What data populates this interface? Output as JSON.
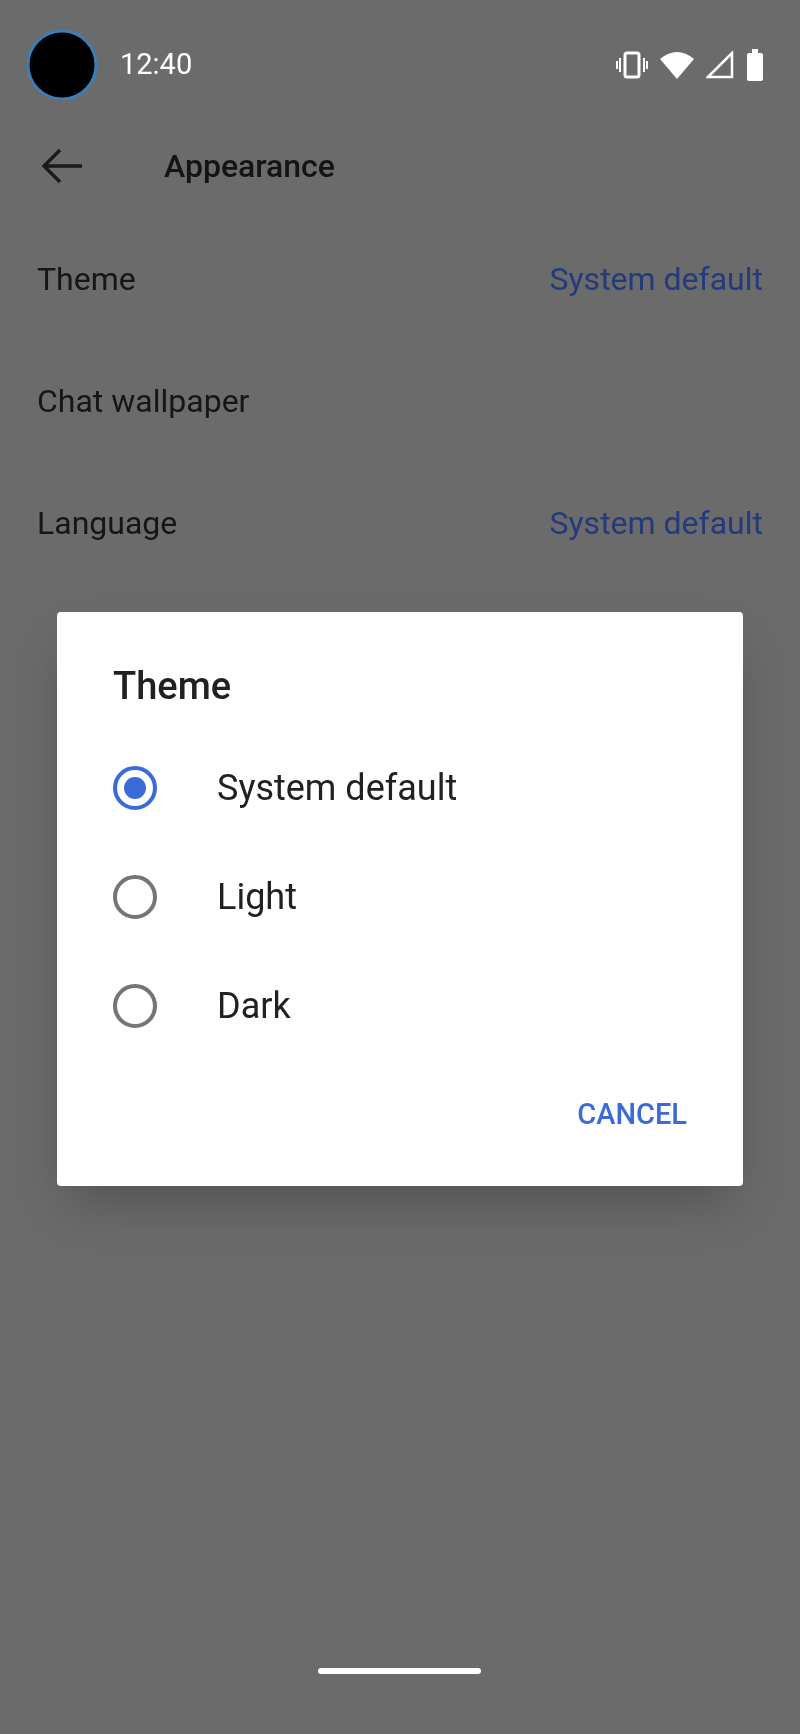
{
  "status_bar": {
    "time": "12:40"
  },
  "toolbar": {
    "title": "Appearance"
  },
  "settings": [
    {
      "label": "Theme",
      "value": "System default"
    },
    {
      "label": "Chat wallpaper"
    },
    {
      "label": "Language",
      "value": "System default"
    }
  ],
  "dialog": {
    "title": "Theme",
    "options": [
      {
        "label": "System default",
        "selected": true
      },
      {
        "label": "Light",
        "selected": false
      },
      {
        "label": "Dark",
        "selected": false
      }
    ],
    "buttons": [
      "CANCEL"
    ]
  }
}
